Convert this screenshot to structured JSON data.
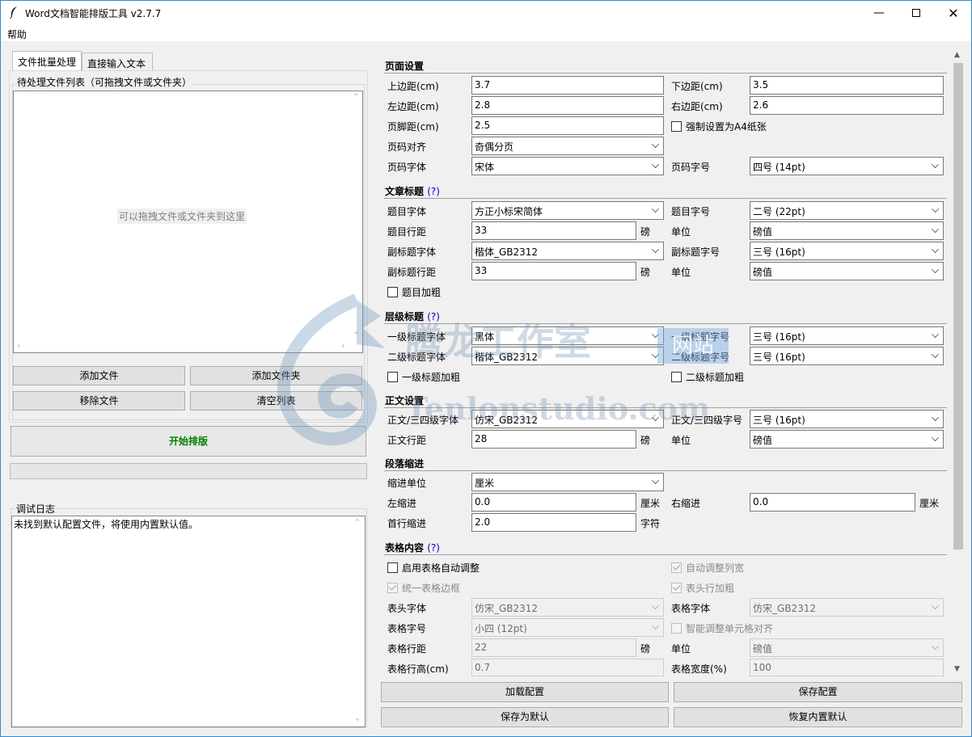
{
  "window": {
    "title": "Word文档智能排版工具 v2.7.7"
  },
  "menu": {
    "help": "帮助"
  },
  "tabs": [
    "文件批量处理",
    "直接输入文本"
  ],
  "file_list": {
    "group_title": "待处理文件列表（可拖拽文件或文件夹）",
    "placeholder": "可以拖拽文件或文件夹到这里"
  },
  "buttons": {
    "add_file": "添加文件",
    "add_folder": "添加文件夹",
    "remove_file": "移除文件",
    "clear_list": "清空列表",
    "start": "开始排版",
    "load_config": "加载配置",
    "save_config": "保存配置",
    "save_default": "保存为默认",
    "restore_default": "恢复内置默认"
  },
  "log": {
    "title": "调试日志",
    "text": "未找到默认配置文件，将使用内置默认值。"
  },
  "page": {
    "section": "页面设置",
    "top_label": "上边距(cm)",
    "top": "3.7",
    "bottom_label": "下边距(cm)",
    "bottom": "3.5",
    "left_label": "左边距(cm)",
    "left": "2.8",
    "right_label": "右边距(cm)",
    "right": "2.6",
    "footer_label": "页脚距(cm)",
    "footer": "2.5",
    "force_a4": "强制设置为A4纸张",
    "num_align_label": "页码对齐",
    "num_align": "奇偶分页",
    "num_font_label": "页码字体",
    "num_font": "宋体",
    "num_size_label": "页码字号",
    "num_size": "四号 (14pt)"
  },
  "title_sec": {
    "section": "文章标题",
    "help": "(?)",
    "font_label": "题目字体",
    "font": "方正小标宋简体",
    "size_label": "题目字号",
    "size": "二号 (22pt)",
    "spacing_label": "题目行距",
    "spacing": "33",
    "unit_pang": "磅",
    "unit_label": "单位",
    "unit": "磅值",
    "sub_font_label": "副标题字体",
    "sub_font": "楷体_GB2312",
    "sub_size_label": "副标题字号",
    "sub_size": "三号 (16pt)",
    "sub_spacing_label": "副标题行距",
    "sub_spacing": "33",
    "sub_unit": "磅值",
    "bold": "题目加粗"
  },
  "heading": {
    "section": "层级标题",
    "help": "(?)",
    "h1_font_label": "一级标题字体",
    "h1_font": "黑体",
    "h1_size_label": "一级标题字号",
    "h1_size": "三号 (16pt)",
    "h2_font_label": "二级标题字体",
    "h2_font": "楷体_GB2312",
    "h2_size_label": "二级标题字号",
    "h2_size": "三号 (16pt)",
    "h1_bold": "一级标题加粗",
    "h2_bold": "二级标题加粗"
  },
  "body": {
    "section": "正文设置",
    "font_label": "正文/三四级字体",
    "font": "仿宋_GB2312",
    "size_label": "正文/三四级字号",
    "size": "三号 (16pt)",
    "spacing_label": "正文行距",
    "spacing": "28",
    "unit_pang": "磅",
    "unit_label": "单位",
    "unit": "磅值"
  },
  "indent": {
    "section": "段落缩进",
    "unit_label": "缩进单位",
    "unit": "厘米",
    "left_label": "左缩进",
    "left": "0.0",
    "cm": "厘米",
    "right_label": "右缩进",
    "right": "0.0",
    "first_label": "首行缩进",
    "first": "2.0",
    "char": "字符"
  },
  "table": {
    "section": "表格内容",
    "help": "(?)",
    "auto_adjust": "启用表格自动调整",
    "auto_width": "自动调整列宽",
    "unify_border": "统一表格边框",
    "header_bold": "表头行加粗",
    "header_font_label": "表头字体",
    "header_font": "仿宋_GB2312",
    "font_label": "表格字体",
    "font": "仿宋_GB2312",
    "size_label": "表格字号",
    "size": "小四 (12pt)",
    "smart_align": "智能调整单元格对齐",
    "spacing_label": "表格行距",
    "spacing": "22",
    "unit_pang": "磅",
    "unit_label": "单位",
    "unit": "磅值",
    "row_height_label": "表格行高(cm)",
    "row_height": "0.7",
    "width_label": "表格宽度(%)",
    "width": "100"
  },
  "watermark": {
    "cn": "腾龙工作室",
    "site": "网站",
    "url": "Tenlonstudio.com"
  },
  "colors": {
    "accent": "#2b8cd6",
    "start_text": "#008000",
    "help": "#0000cc"
  }
}
